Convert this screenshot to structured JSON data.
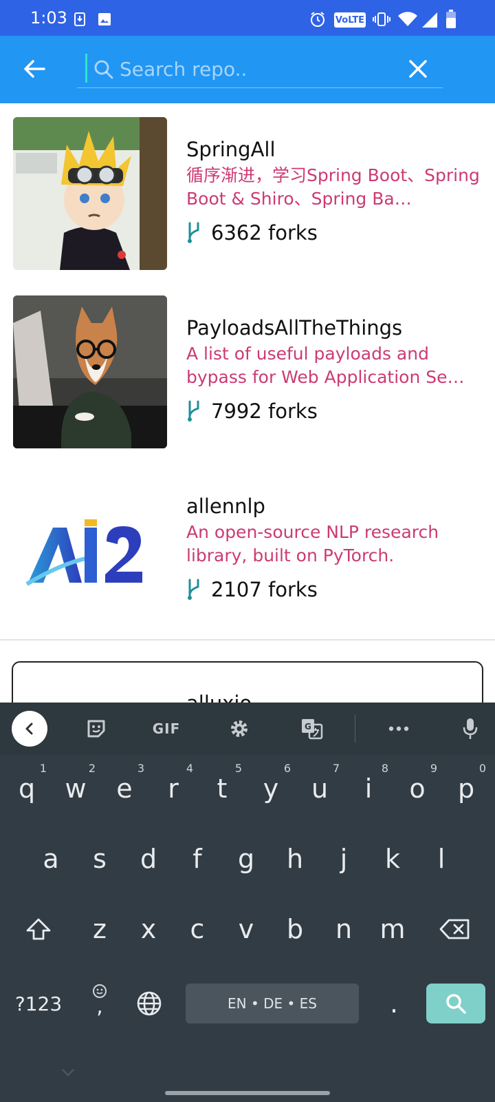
{
  "status_bar": {
    "time": "1:03",
    "volte_label": "VoLTE",
    "icons": [
      "download-icon",
      "image-icon",
      "alarm-icon",
      "volte-icon",
      "vibrate-icon",
      "wifi-icon",
      "signal-icon",
      "battery-icon"
    ]
  },
  "app_bar": {
    "search_placeholder": "Search repo..",
    "search_value": ""
  },
  "repos": [
    {
      "name": "SpringAll",
      "description": "循序渐进，学习Spring Boot、Spring Boot & Shiro、Spring Ba…",
      "forks": "6362 forks",
      "avatar": "anime-character-avatar"
    },
    {
      "name": "PayloadsAllTheThings",
      "description": "A list of useful payloads and bypass for Web Application Se…",
      "forks": "7992 forks",
      "avatar": "shiba-dog-with-glasses-avatar"
    },
    {
      "name": "allennlp",
      "description": "An open-source NLP research library, built on PyTorch.",
      "forks": "2107 forks",
      "avatar": "ai2-logo",
      "logo_text": "AI2"
    },
    {
      "name": "alluxio",
      "description": "",
      "forks": ""
    }
  ],
  "keyboard": {
    "toolbar": {
      "gif_label": "GIF",
      "icons": [
        "collapse-icon",
        "sticker-icon",
        "gif-icon",
        "settings-icon",
        "translate-icon",
        "more-icon",
        "mic-icon"
      ]
    },
    "row1": [
      {
        "key": "q",
        "hint": "1"
      },
      {
        "key": "w",
        "hint": "2"
      },
      {
        "key": "e",
        "hint": "3"
      },
      {
        "key": "r",
        "hint": "4"
      },
      {
        "key": "t",
        "hint": "5"
      },
      {
        "key": "y",
        "hint": "6"
      },
      {
        "key": "u",
        "hint": "7"
      },
      {
        "key": "i",
        "hint": "8"
      },
      {
        "key": "o",
        "hint": "9"
      },
      {
        "key": "p",
        "hint": "0"
      }
    ],
    "row2": [
      "a",
      "s",
      "d",
      "f",
      "g",
      "h",
      "j",
      "k",
      "l"
    ],
    "row3": [
      "z",
      "x",
      "c",
      "v",
      "b",
      "n",
      "m"
    ],
    "symbols_label": "?123",
    "comma_label": ",",
    "period_label": ".",
    "space_label": "EN • DE • ES",
    "accent_color": "#7fd0c8"
  },
  "colors": {
    "status_bar": "#2f63e6",
    "app_bar": "#2196f3",
    "description": "#c2185b",
    "fork_icon": "#1e8f9a",
    "keyboard_bg": "#323c44"
  }
}
